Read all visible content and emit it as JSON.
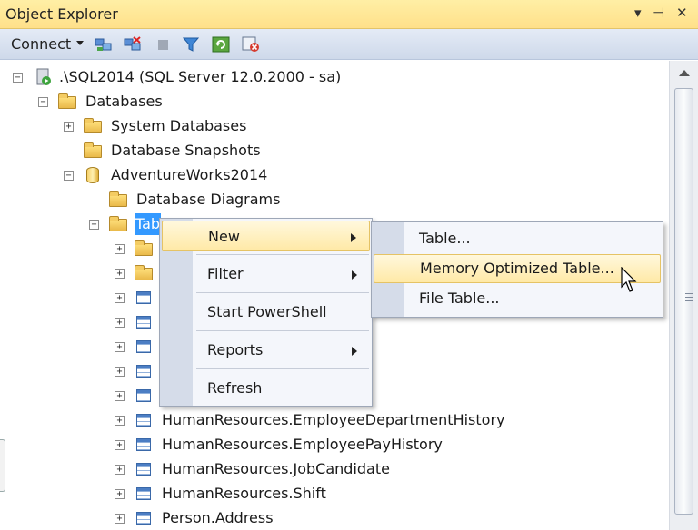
{
  "window": {
    "title": "Object Explorer",
    "controls": {
      "dropdown": "▾",
      "pin": "⊣",
      "close": "✕"
    }
  },
  "toolbar": {
    "connect_label": "Connect",
    "icons": [
      "connect-object-explorer-icon",
      "disconnect-icon",
      "stop-icon",
      "filter-icon",
      "refresh-icon",
      "stop-powershell-icon"
    ]
  },
  "tree": {
    "server": ".\\SQL2014 (SQL Server 12.0.2000 - sa)",
    "databases": "Databases",
    "system_databases": "System Databases",
    "database_snapshots": "Database Snapshots",
    "adventureworks": "AdventureWorks2014",
    "database_diagrams": "Database Diagrams",
    "tables": "Tab",
    "table_rows": [
      "HumanResources.EmployeeDepartmentHistory",
      "HumanResources.EmployeePayHistory",
      "HumanResources.JobCandidate",
      "HumanResources.Shift",
      "Person.Address"
    ]
  },
  "context_menu": {
    "items": [
      "New",
      "Filter",
      "Start PowerShell",
      "Reports",
      "Refresh"
    ]
  },
  "submenu": {
    "items": [
      "Table...",
      "Memory Optimized Table...",
      "File Table..."
    ]
  },
  "colors": {
    "title_bar": "#ffe08a",
    "selection": "#3399ff",
    "menu_highlight": "#ffe9a6"
  }
}
